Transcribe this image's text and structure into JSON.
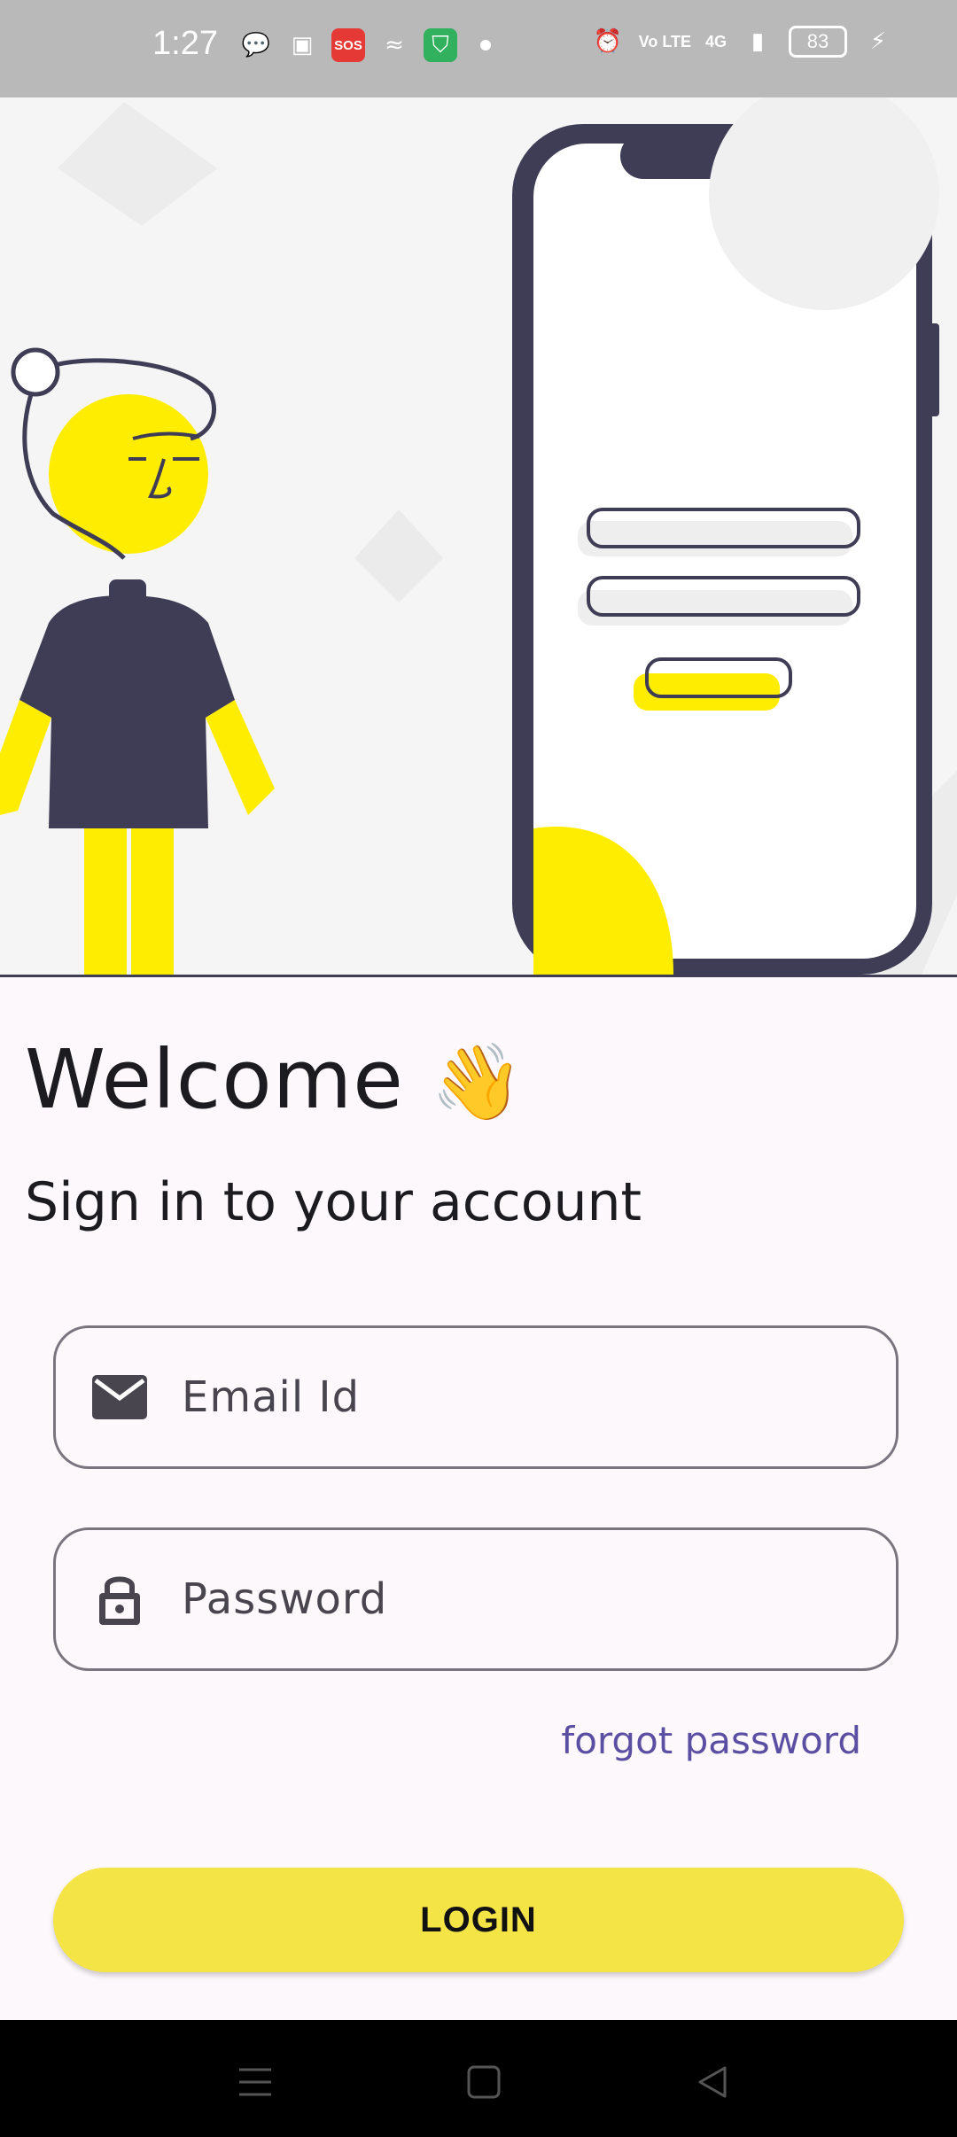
{
  "status_bar": {
    "time": "1:27",
    "battery": "83",
    "network": "4G",
    "volte": "Vo LTE",
    "sos": "SOS"
  },
  "welcome": {
    "title": "Welcome",
    "emoji": "👋",
    "subtitle": "Sign in to your account"
  },
  "form": {
    "email_placeholder": "Email Id",
    "password_placeholder": "Password",
    "forgot_label": "forgot password",
    "login_label": "LOGIN"
  },
  "colors": {
    "accent_yellow": "#f5e446",
    "link_purple": "#5b4fa3",
    "illustration_dark": "#3f3d56",
    "illustration_yellow": "#ffed00"
  },
  "icons": {
    "email": "mail-icon",
    "password": "lock-icon",
    "nav_menu": "menu-icon",
    "nav_home": "home-icon",
    "nav_back": "back-icon"
  }
}
